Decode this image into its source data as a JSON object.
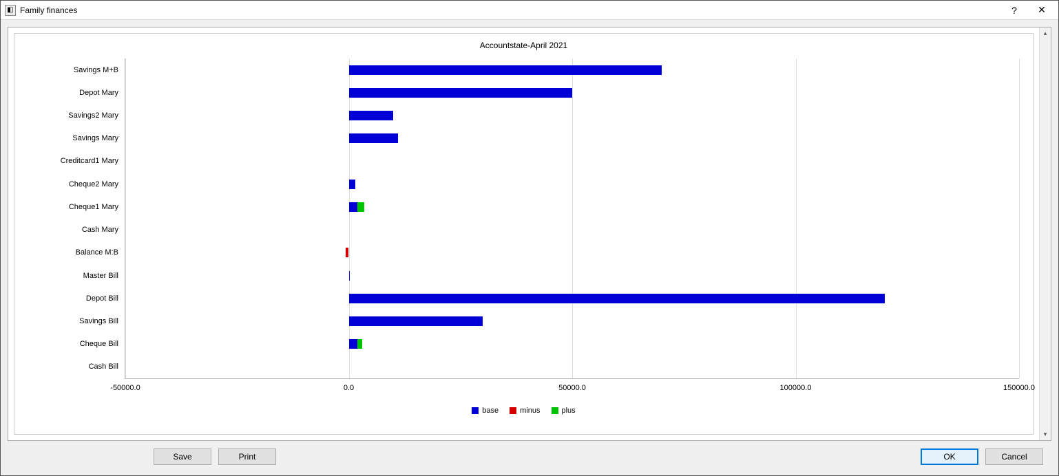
{
  "window": {
    "title": "Family finances"
  },
  "buttons": {
    "save": "Save",
    "print": "Print",
    "ok": "OK",
    "cancel": "Cancel",
    "help": "?",
    "close": "✕"
  },
  "chart_data": {
    "type": "bar",
    "orientation": "horizontal",
    "stacked": true,
    "title": "Accountstate-April 2021",
    "xlabel": "",
    "ylabel": "",
    "xlim": [
      -50000,
      150000
    ],
    "xticks": [
      -50000,
      0,
      50000,
      100000,
      150000
    ],
    "xtick_labels": [
      "-50000.0",
      "0.0",
      "50000.0",
      "100000.0",
      "150000.0"
    ],
    "categories": [
      "Savings M+B",
      "Depot Mary",
      "Savings2 Mary",
      "Savings Mary",
      "Creditcard1 Mary",
      "Cheque2 Mary",
      "Cheque1 Mary",
      "Cash Mary",
      "Balance M:B",
      "Master Bill",
      "Depot Bill",
      "Savings Bill",
      "Cheque Bill",
      "Cash Bill"
    ],
    "series": [
      {
        "name": "base",
        "color": "#0000d6",
        "values": [
          70000,
          50000,
          10000,
          11000,
          0,
          1500,
          2000,
          0,
          0,
          300,
          120000,
          30000,
          2000,
          0
        ]
      },
      {
        "name": "minus",
        "color": "#d40000",
        "values": [
          0,
          0,
          0,
          0,
          0,
          0,
          0,
          0,
          -700,
          0,
          0,
          0,
          0,
          0
        ]
      },
      {
        "name": "plus",
        "color": "#00c400",
        "values": [
          0,
          0,
          0,
          0,
          0,
          0,
          1500,
          0,
          0,
          0,
          0,
          0,
          1000,
          0
        ]
      }
    ],
    "legend": [
      "base",
      "minus",
      "plus"
    ]
  }
}
